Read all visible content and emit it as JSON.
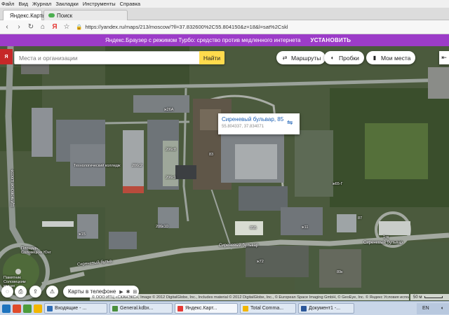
{
  "browser": {
    "menu": [
      "Файл",
      "Вид",
      "Журнал",
      "Закладки",
      "Инструменты",
      "Справка"
    ],
    "tabs": [
      {
        "label": "Яндекс.Карты",
        "active": true
      },
      {
        "label": "Поиск",
        "active": false
      }
    ],
    "url": "https://yandex.ru/maps/213/moscow/?ll=37.832600%2C55.804150&z=18&l=sat%2Cskl",
    "turbo_message": "Яндекс.Браузер с режимом Турбо: средство против медленного интернета",
    "turbo_install": "УСТАНОВИТЬ"
  },
  "search": {
    "placeholder": "Места и организации",
    "button": "Найти"
  },
  "toolbar": {
    "routes": "Маршруты",
    "traffic": "Пробки",
    "my_places": "Мои места"
  },
  "balloon": {
    "address": "Сиреневый бульвар, 85",
    "coords": "55.804337, 37.834071"
  },
  "map_labels": {
    "college": "Технологический колледж",
    "bld_a": "206с2",
    "bld_b": "206с8",
    "bld_c": "206с1",
    "bld_d": "83",
    "bld_e": "ж65-Г",
    "bld_f": "85Б",
    "bld_g": "206к10",
    "bld_h": "ж26А",
    "bld_i": "ж72",
    "bld_j": "87",
    "bld_k": "1тк",
    "bld_l": "ж11",
    "bld_m": "ж15",
    "bld_n": "89к",
    "road_1": "Сиреневый бульвар",
    "road_2": "Сиреневый бульв.",
    "road_3": "Сиреневый бульвар",
    "street_v": "Щёлковское шоссе",
    "square": "Площадь Соловецких Юнг",
    "monument": "Памятник Соловецким юнгам"
  },
  "phone_button": "Карты в телефоне",
  "store_icons": "▶ ✱ ⊞",
  "copyright": "© ООО ИТЦ «СКАНЭКС», Image © 2012 DigitalGlobe, Inc., Includes material © 2012 DigitalGlobe, Inc., © European Space Imaging GmbH, © GeoEye, Inc. © Яндекс  Условия использования",
  "scale": "50 м",
  "taskbar": {
    "items": [
      {
        "label": "Входящие - ...",
        "color": "#2f6db5"
      },
      {
        "label": "General.kdbx...",
        "color": "#4a8f3c"
      },
      {
        "label": "Яндекс.Карт...",
        "color": "#e53935"
      },
      {
        "label": "Total Comma...",
        "color": "#f2b600"
      },
      {
        "label": "Документ1 -...",
        "color": "#2b579a"
      }
    ],
    "tray": "EN"
  },
  "colors": {
    "turbo": "#9c3cc8",
    "find_button": "#ffdb4d",
    "link": "#1a5fb4"
  }
}
